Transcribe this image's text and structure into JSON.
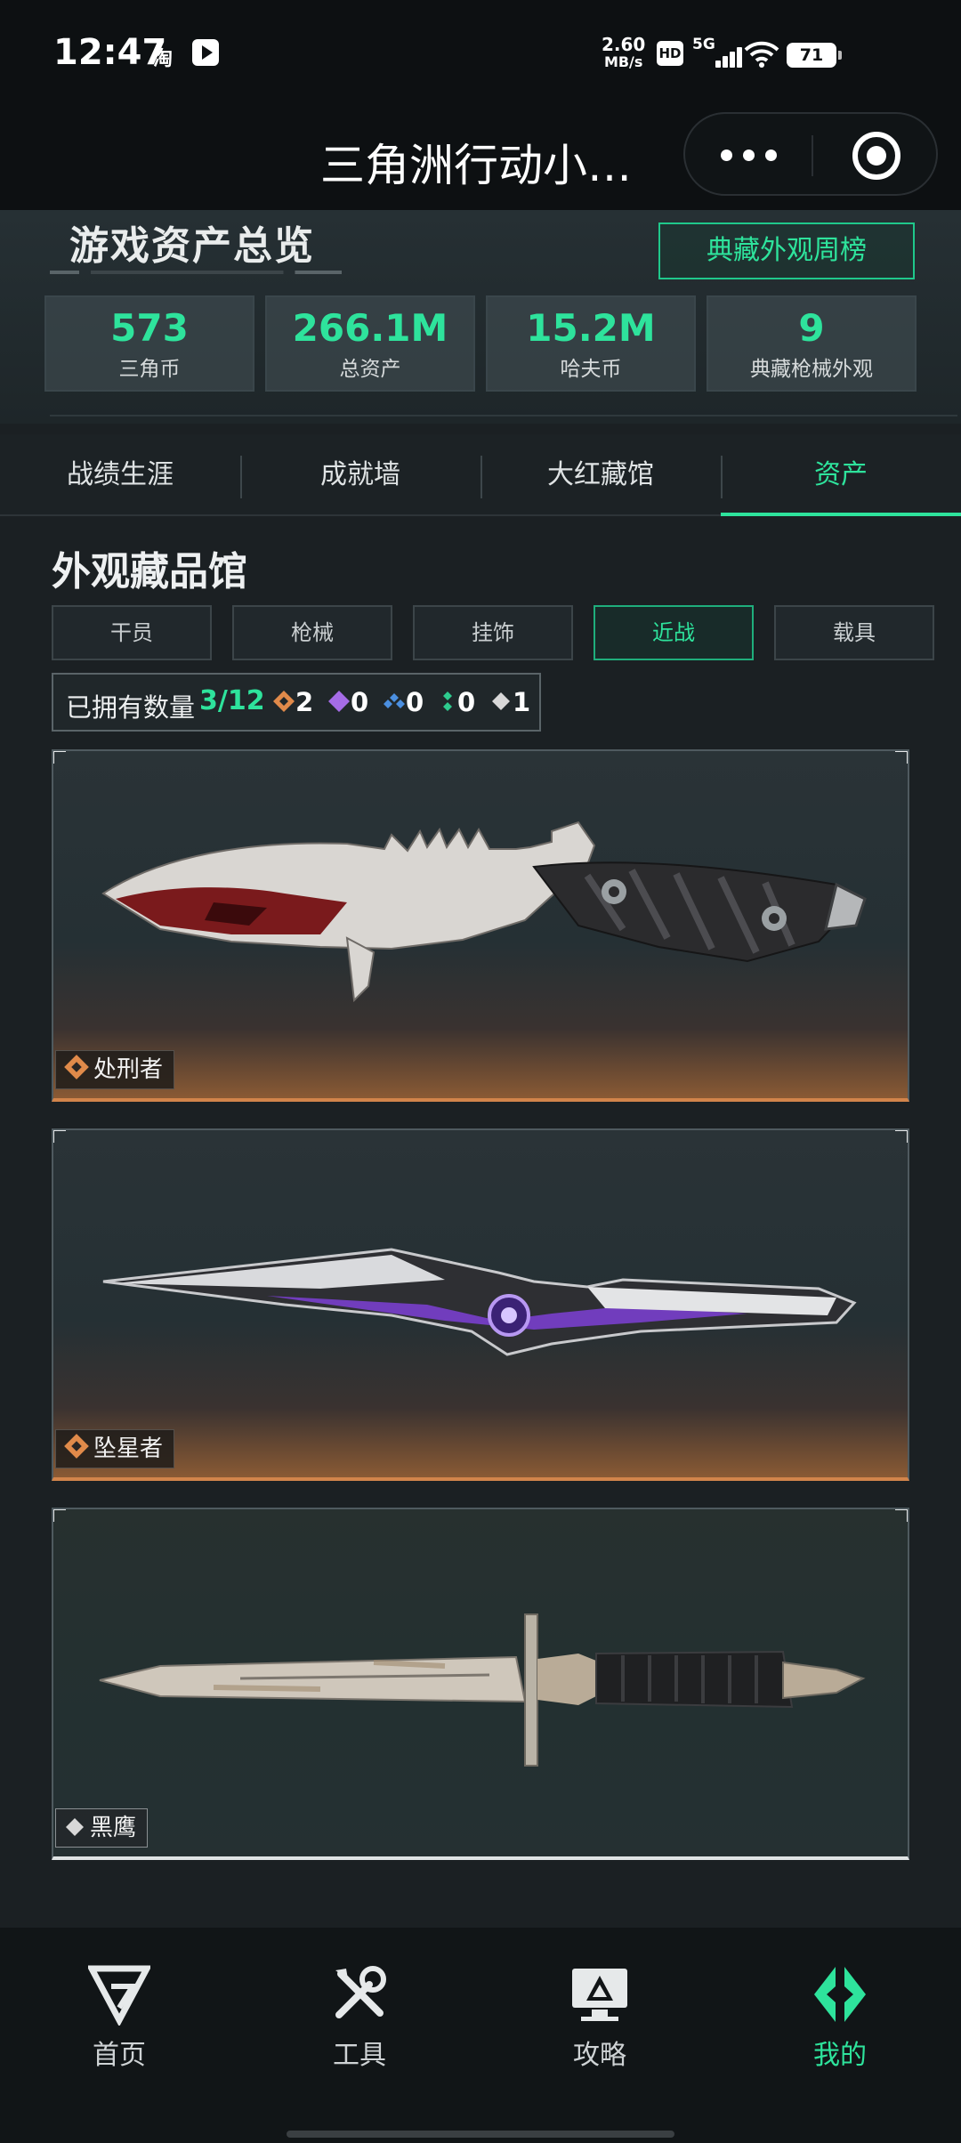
{
  "status_bar": {
    "time": "12:47",
    "taobao_glyph": "淘",
    "net_speed_value": "2.60",
    "net_speed_unit": "MB/s",
    "hd": "HD",
    "network": "5G",
    "battery": "71",
    "icons": [
      "taobao-icon",
      "play-icon",
      "signal-icon",
      "wifi-icon",
      "battery-icon"
    ]
  },
  "title_bar": {
    "title": "三角洲行动小…",
    "icons": [
      "more-icon",
      "close-mini-program-icon"
    ]
  },
  "overview": {
    "title": "游戏资产总览",
    "weekly_rank_button": "典藏外观周榜",
    "stats": [
      {
        "value": "573",
        "label": "三角币"
      },
      {
        "value": "266.1M",
        "label": "总资产"
      },
      {
        "value": "15.2M",
        "label": "哈夫币"
      },
      {
        "value": "9",
        "label": "典藏枪械外观"
      }
    ]
  },
  "main_tabs": {
    "items": [
      "战绩生涯",
      "成就墙",
      "大红藏馆",
      "资产"
    ],
    "active": "资产"
  },
  "collection": {
    "title": "外观藏品馆",
    "categories": [
      "干员",
      "枪械",
      "挂饰",
      "近战",
      "载具"
    ],
    "active_category": "近战",
    "owned_label": "已拥有数量",
    "owned_count": "3/12",
    "rarity_counts": [
      {
        "color": "#e08a4a",
        "count": "2"
      },
      {
        "color": "#a56ce6",
        "count": "0"
      },
      {
        "color": "#4b8fe0",
        "count": "0"
      },
      {
        "color": "#2ecb8e",
        "count": "0"
      },
      {
        "color": "#d8d8d8",
        "count": "1"
      }
    ],
    "items": [
      {
        "name": "处刑者",
        "rarity_color": "#e08a4a"
      },
      {
        "name": "坠星者",
        "rarity_color": "#e08a4a"
      },
      {
        "name": "黑鹰",
        "rarity_color": "#d8d8d8"
      }
    ]
  },
  "bottom_nav": {
    "items": [
      {
        "label": "首页",
        "icon": "home-logo-icon"
      },
      {
        "label": "工具",
        "icon": "tools-icon"
      },
      {
        "label": "攻略",
        "icon": "guide-icon"
      },
      {
        "label": "我的",
        "icon": "profile-icon"
      }
    ],
    "active": "我的"
  },
  "colors": {
    "accent": "#2ee39c",
    "background": "#1b2023"
  }
}
